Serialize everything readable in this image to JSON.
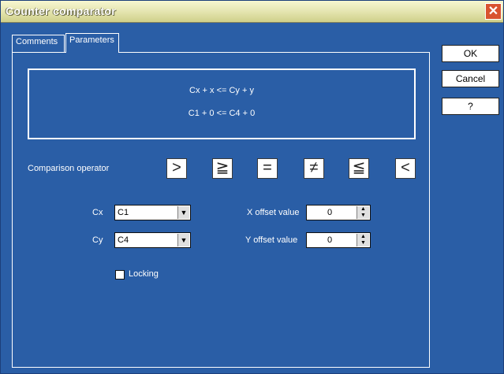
{
  "window": {
    "title": "Counter comparator",
    "close_glyph": "✕"
  },
  "tabs": [
    {
      "label": "Comments",
      "active": false
    },
    {
      "label": "Parameters",
      "active": true
    }
  ],
  "formula": {
    "line1": "Cx + x <= Cy + y",
    "line2": "C1 + 0 <= C4 + 0"
  },
  "comparison": {
    "label": "Comparison operator",
    "operators": [
      {
        "name": "greater",
        "symbol": ">"
      },
      {
        "name": "greater-equal",
        "symbol": "≧"
      },
      {
        "name": "equal",
        "symbol": "="
      },
      {
        "name": "not-equal",
        "symbol": "≠"
      },
      {
        "name": "less-equal",
        "symbol": "≦"
      },
      {
        "name": "less",
        "symbol": "<"
      }
    ]
  },
  "cx": {
    "label": "Cx",
    "value": "C1",
    "arrow": "▼"
  },
  "cy": {
    "label": "Cy",
    "value": "C4",
    "arrow": "▼"
  },
  "x_offset": {
    "label": "X offset value",
    "value": "0",
    "up": "▲",
    "down": "▼"
  },
  "y_offset": {
    "label": "Y offset value",
    "value": "0",
    "up": "▲",
    "down": "▼"
  },
  "locking": {
    "label": "Locking",
    "checked": false
  },
  "buttons": {
    "ok": "OK",
    "cancel": "Cancel",
    "help": "?"
  },
  "colors": {
    "background": "#2a5ea6",
    "titlebar": "#e7e7b4",
    "close": "#d9532f"
  }
}
